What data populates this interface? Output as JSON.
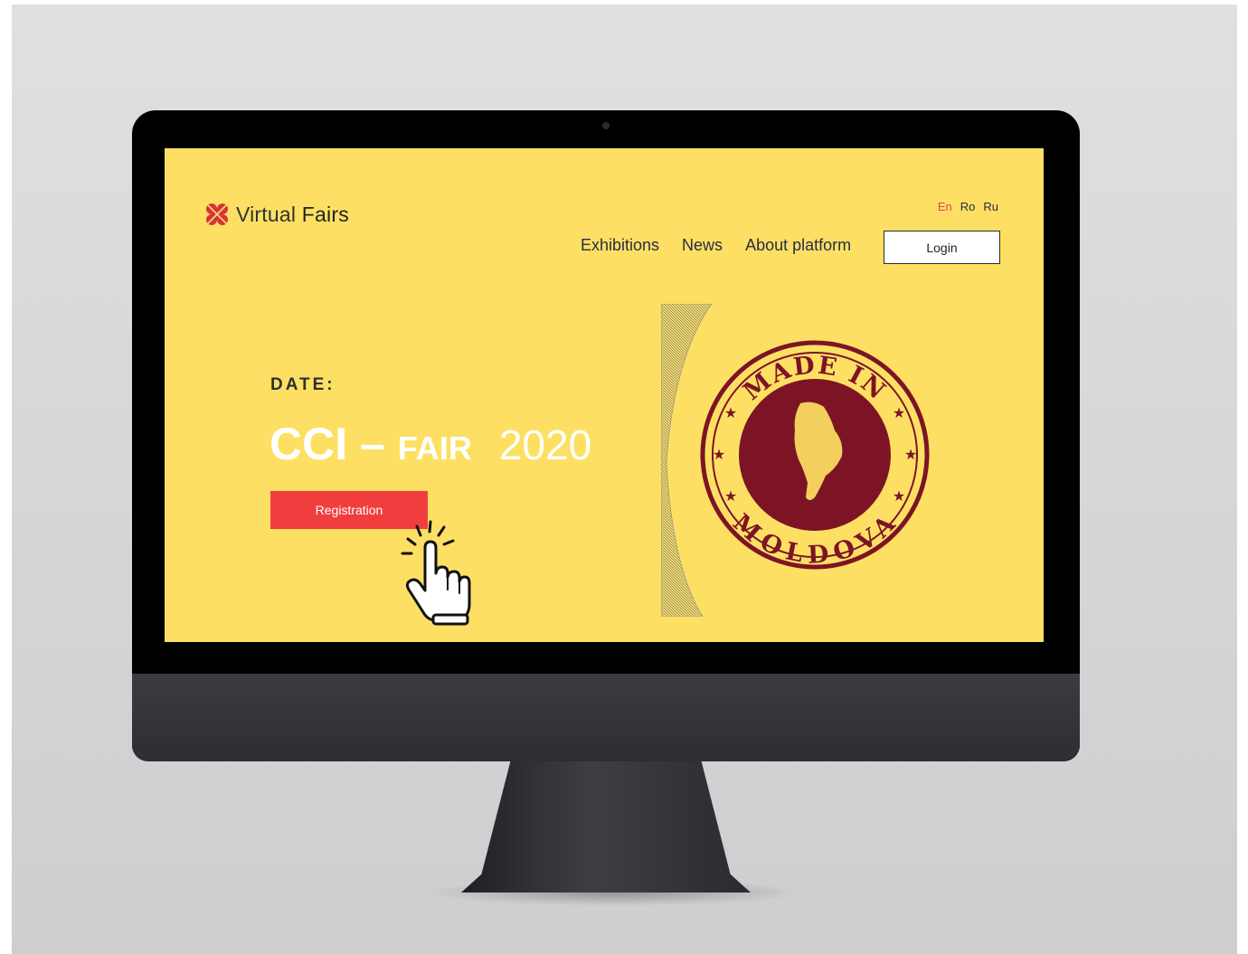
{
  "site": {
    "brand": {
      "name_light": "Virtual",
      "name_bold": "Fairs"
    },
    "languages": [
      {
        "label": "En",
        "active": true
      },
      {
        "label": "Ro",
        "active": false
      },
      {
        "label": "Ru",
        "active": false
      }
    ],
    "nav": [
      {
        "label": "Exhibitions"
      },
      {
        "label": "News"
      },
      {
        "label": "About platform"
      }
    ],
    "login_label": "Login"
  },
  "hero": {
    "date_label": "DATE:",
    "title_part1": "CCI –",
    "title_part2": "FAIR",
    "title_part3": "2020",
    "registration_label": "Registration"
  },
  "stamp": {
    "top_text": "MADE IN",
    "bottom_text": "MOLDOVA",
    "color": "#7d1426"
  },
  "colors": {
    "page_bg": "#fde063",
    "accent_red": "#f03e3e",
    "lang_active": "#e8405b",
    "logo_red": "#d6333f"
  },
  "icons": {
    "logo": "virtual-fairs-logo-icon",
    "cursor": "pointing-hand-icon"
  }
}
